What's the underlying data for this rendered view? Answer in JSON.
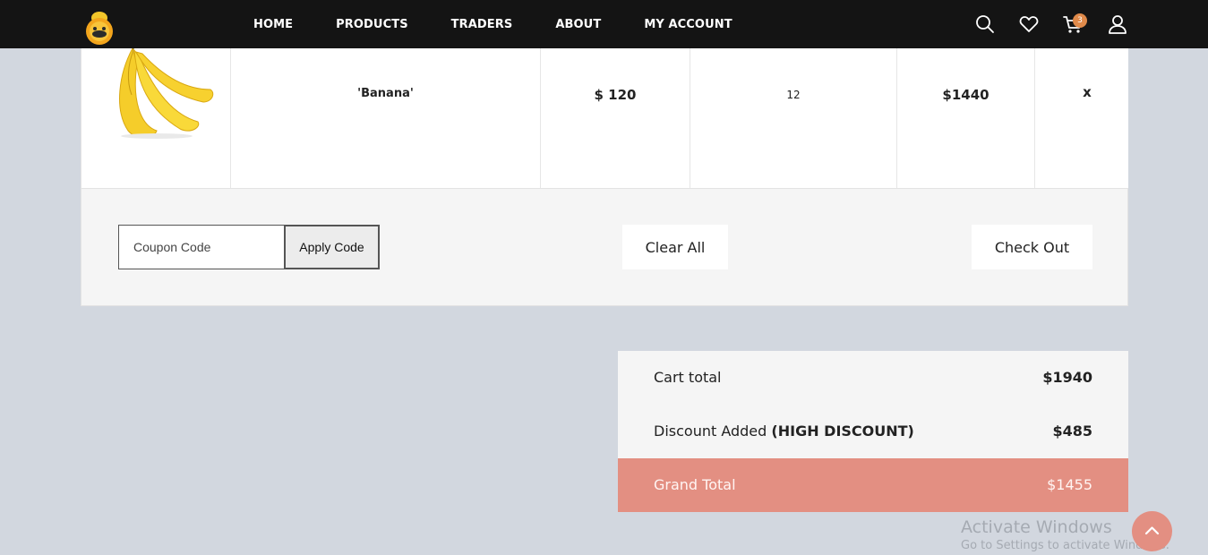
{
  "nav": {
    "items": [
      "HOME",
      "PRODUCTS",
      "TRADERS",
      "ABOUT",
      "MY ACCOUNT"
    ],
    "cart_count": "3"
  },
  "cart": {
    "rows": [
      {
        "image": "banana",
        "name": "'Banana'",
        "price": "$ 120",
        "quantity": "12",
        "subtotal": "$1440",
        "remove": "x"
      }
    ]
  },
  "actions": {
    "coupon_placeholder": "Coupon Code",
    "apply_label": "Apply Code",
    "clear_label": "Clear All",
    "checkout_label": "Check Out"
  },
  "totals": {
    "cart_total_label": "Cart total",
    "cart_total_value": "$1940",
    "discount_label": "Discount Added",
    "discount_name": "(HIGH DISCOUNT)",
    "discount_value": "$485",
    "grand_total_label": "Grand Total",
    "grand_total_value": "$1455"
  },
  "watermark": {
    "line1": "Activate Windows",
    "line2": "Go to Settings to activate Windows."
  },
  "colors": {
    "nav_bg": "#141414",
    "accent": "#e38f82",
    "page_bg": "#d2d7df"
  }
}
